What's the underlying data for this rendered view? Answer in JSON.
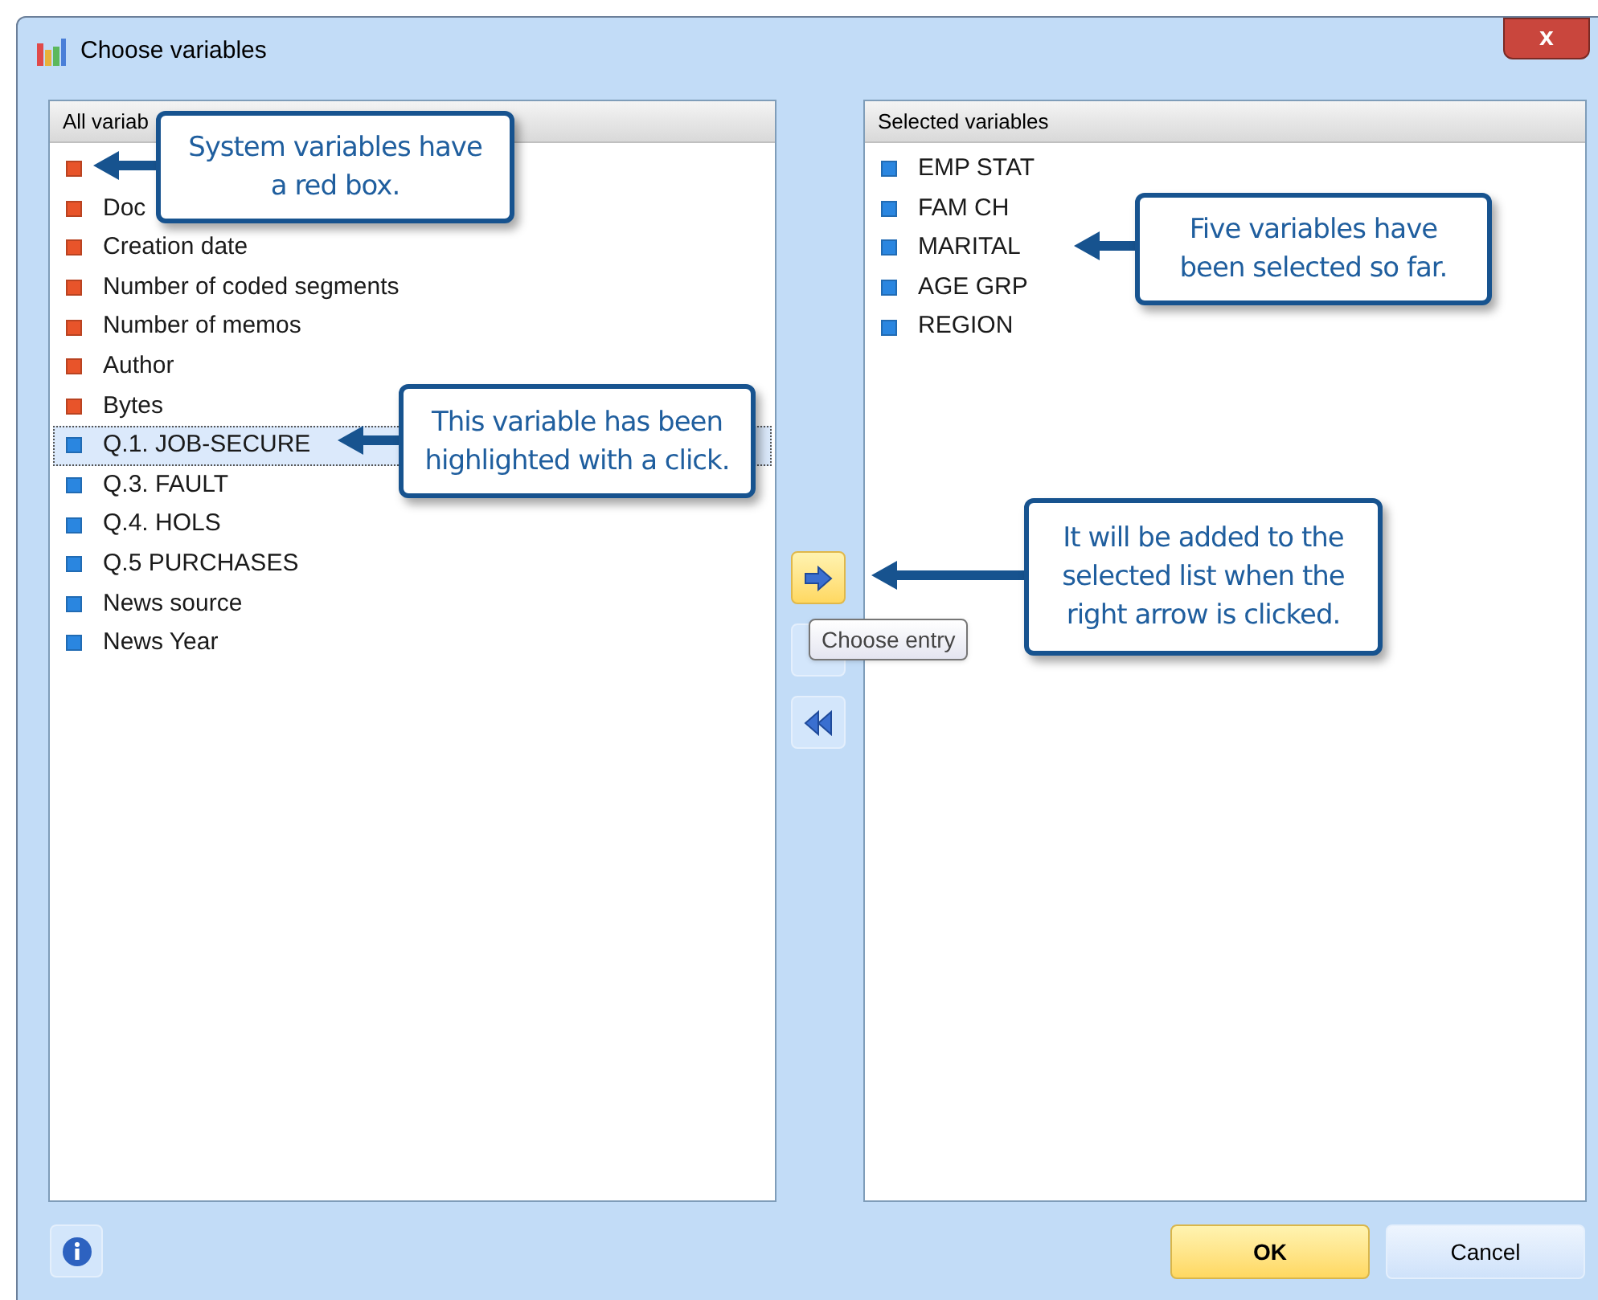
{
  "window": {
    "title": "Choose variables",
    "close_label": "x"
  },
  "all_variables": {
    "header": "All variab",
    "items": [
      {
        "color": "#e8542a",
        "selected": false
      },
      {
        "label": "Doc",
        "color": "#e8542a",
        "selected": false
      },
      {
        "label": "Creation date",
        "color": "#e8542a",
        "selected": false
      },
      {
        "label": "Number of coded segments",
        "color": "#e8542a",
        "selected": false
      },
      {
        "label": "Number of memos",
        "color": "#e8542a",
        "selected": false
      },
      {
        "label": "Author",
        "color": "#e8542a",
        "selected": false
      },
      {
        "label": "Bytes",
        "color": "#e8542a",
        "selected": false
      },
      {
        "label": "Q.1. JOB-SECURE",
        "color": "#2a86e0",
        "selected": true
      },
      {
        "label": "Q.3. FAULT",
        "color": "#2a86e0",
        "selected": false
      },
      {
        "label": "Q.4. HOLS",
        "color": "#2a86e0",
        "selected": false
      },
      {
        "label": "Q.5 PURCHASES",
        "color": "#2a86e0",
        "selected": false
      },
      {
        "label": "News source",
        "color": "#2a86e0",
        "selected": false
      },
      {
        "label": "News Year",
        "color": "#2a86e0",
        "selected": false
      }
    ]
  },
  "selected_variables": {
    "header": "Selected variables",
    "items": [
      {
        "label": "EMP STAT",
        "color": "#2a86e0"
      },
      {
        "label": "FAM CH",
        "color": "#2a86e0"
      },
      {
        "label": "MARITAL",
        "color": "#2a86e0"
      },
      {
        "label": "AGE GRP",
        "color": "#2a86e0"
      },
      {
        "label": "REGION",
        "color": "#2a86e0"
      }
    ]
  },
  "tooltip": "Choose entry",
  "callouts": [
    {
      "text": "System variables have a red box."
    },
    {
      "text": "This variable has been highlighted with a click."
    },
    {
      "text": "Five variables have been selected so far."
    },
    {
      "text": "It will be added to the selected list when the right arrow is clicked."
    }
  ],
  "buttons": [
    {
      "label": "OK",
      "kind": "primary"
    },
    {
      "label": "Cancel",
      "kind": "secondary"
    }
  ]
}
